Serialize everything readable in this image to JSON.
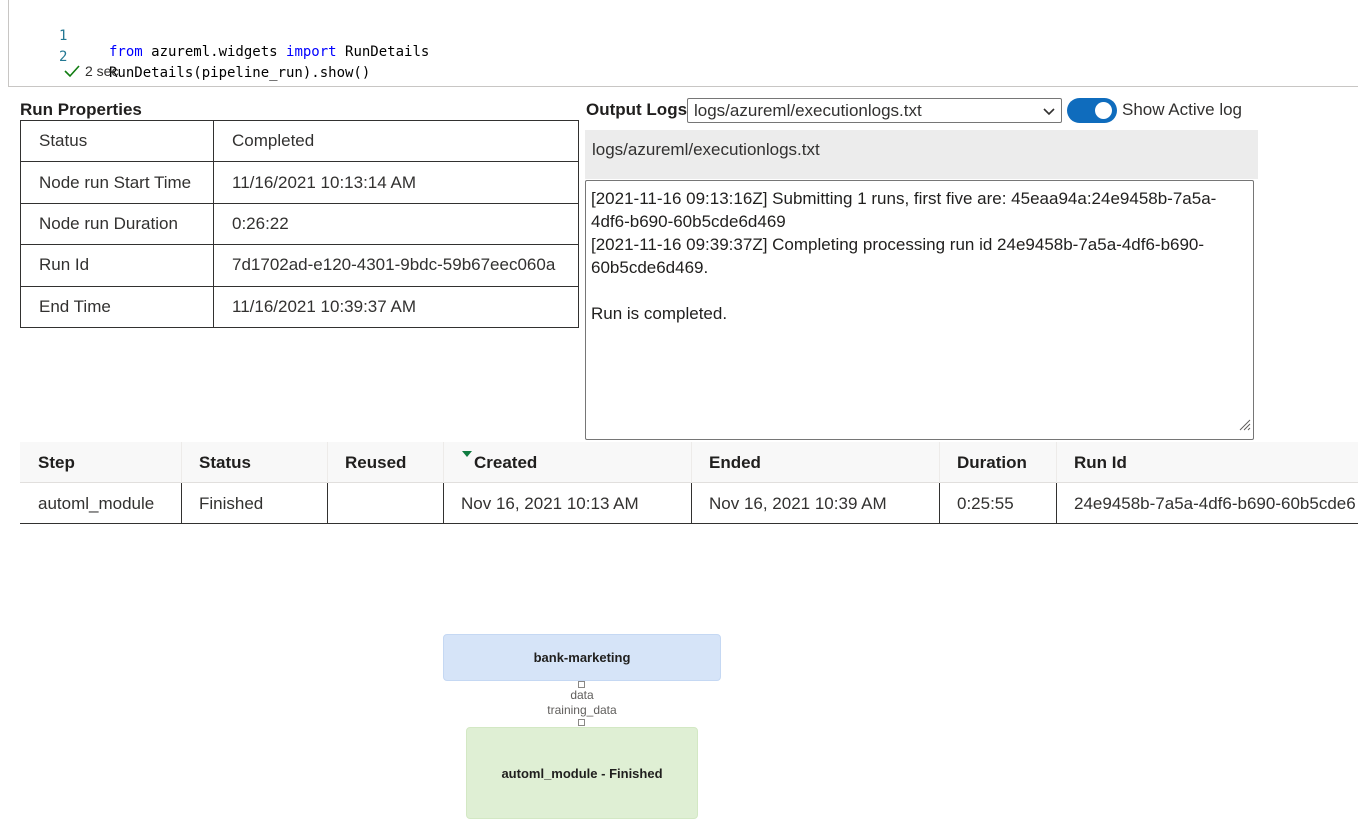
{
  "code": {
    "lines": [
      {
        "num": "1",
        "t1": "from",
        "t2": " azureml.widgets ",
        "t3": "import",
        "t4": " RunDetails"
      },
      {
        "num": "2",
        "text": "RunDetails(pipeline_run).show()"
      }
    ],
    "exec_time": "2 sec"
  },
  "run_properties": {
    "title": "Run Properties",
    "rows": [
      {
        "key": "Status",
        "value": "Completed"
      },
      {
        "key": "Node run Start Time",
        "value": "11/16/2021 10:13:14 AM"
      },
      {
        "key": "Node run Duration",
        "value": "0:26:22"
      },
      {
        "key": "Run Id",
        "value": "7d1702ad-e120-4301-9bdc-59b67eec060a"
      },
      {
        "key": "End Time",
        "value": "11/16/2021 10:39:37 AM"
      }
    ]
  },
  "output_logs": {
    "title": "Output Logs",
    "selected_log": "logs/azureml/executionlogs.txt",
    "show_active_log_label": "Show Active log",
    "show_active_log": true,
    "path": "logs/azureml/executionlogs.txt",
    "content": "[2021-11-16 09:13:16Z] Submitting 1 runs, first five are: 45eaa94a:24e9458b-7a5a-4df6-b690-60b5cde6d469\n[2021-11-16 09:39:37Z] Completing processing run id 24e9458b-7a5a-4df6-b690-60b5cde6d469.\n\nRun is completed."
  },
  "steps": {
    "headers": [
      "Step",
      "Status",
      "Reused",
      "Created",
      "Ended",
      "Duration",
      "Run Id"
    ],
    "rows": [
      [
        "automl_module",
        "Finished",
        "",
        "Nov 16, 2021 10:13 AM",
        "Nov 16, 2021 10:39 AM",
        "0:25:55",
        "24e9458b-7a5a-4df6-b690-60b5cde6"
      ]
    ],
    "sorted_column": "Created"
  },
  "graph": {
    "data_node": "bank-marketing",
    "edge_labels": [
      "data",
      "training_data"
    ],
    "module_node": "automl_module - Finished"
  },
  "colors": {
    "accent": "#0f6cbd",
    "data_node": "#d6e4f8",
    "module_node": "#dfefd4",
    "sort_indicator": "#107c41"
  }
}
